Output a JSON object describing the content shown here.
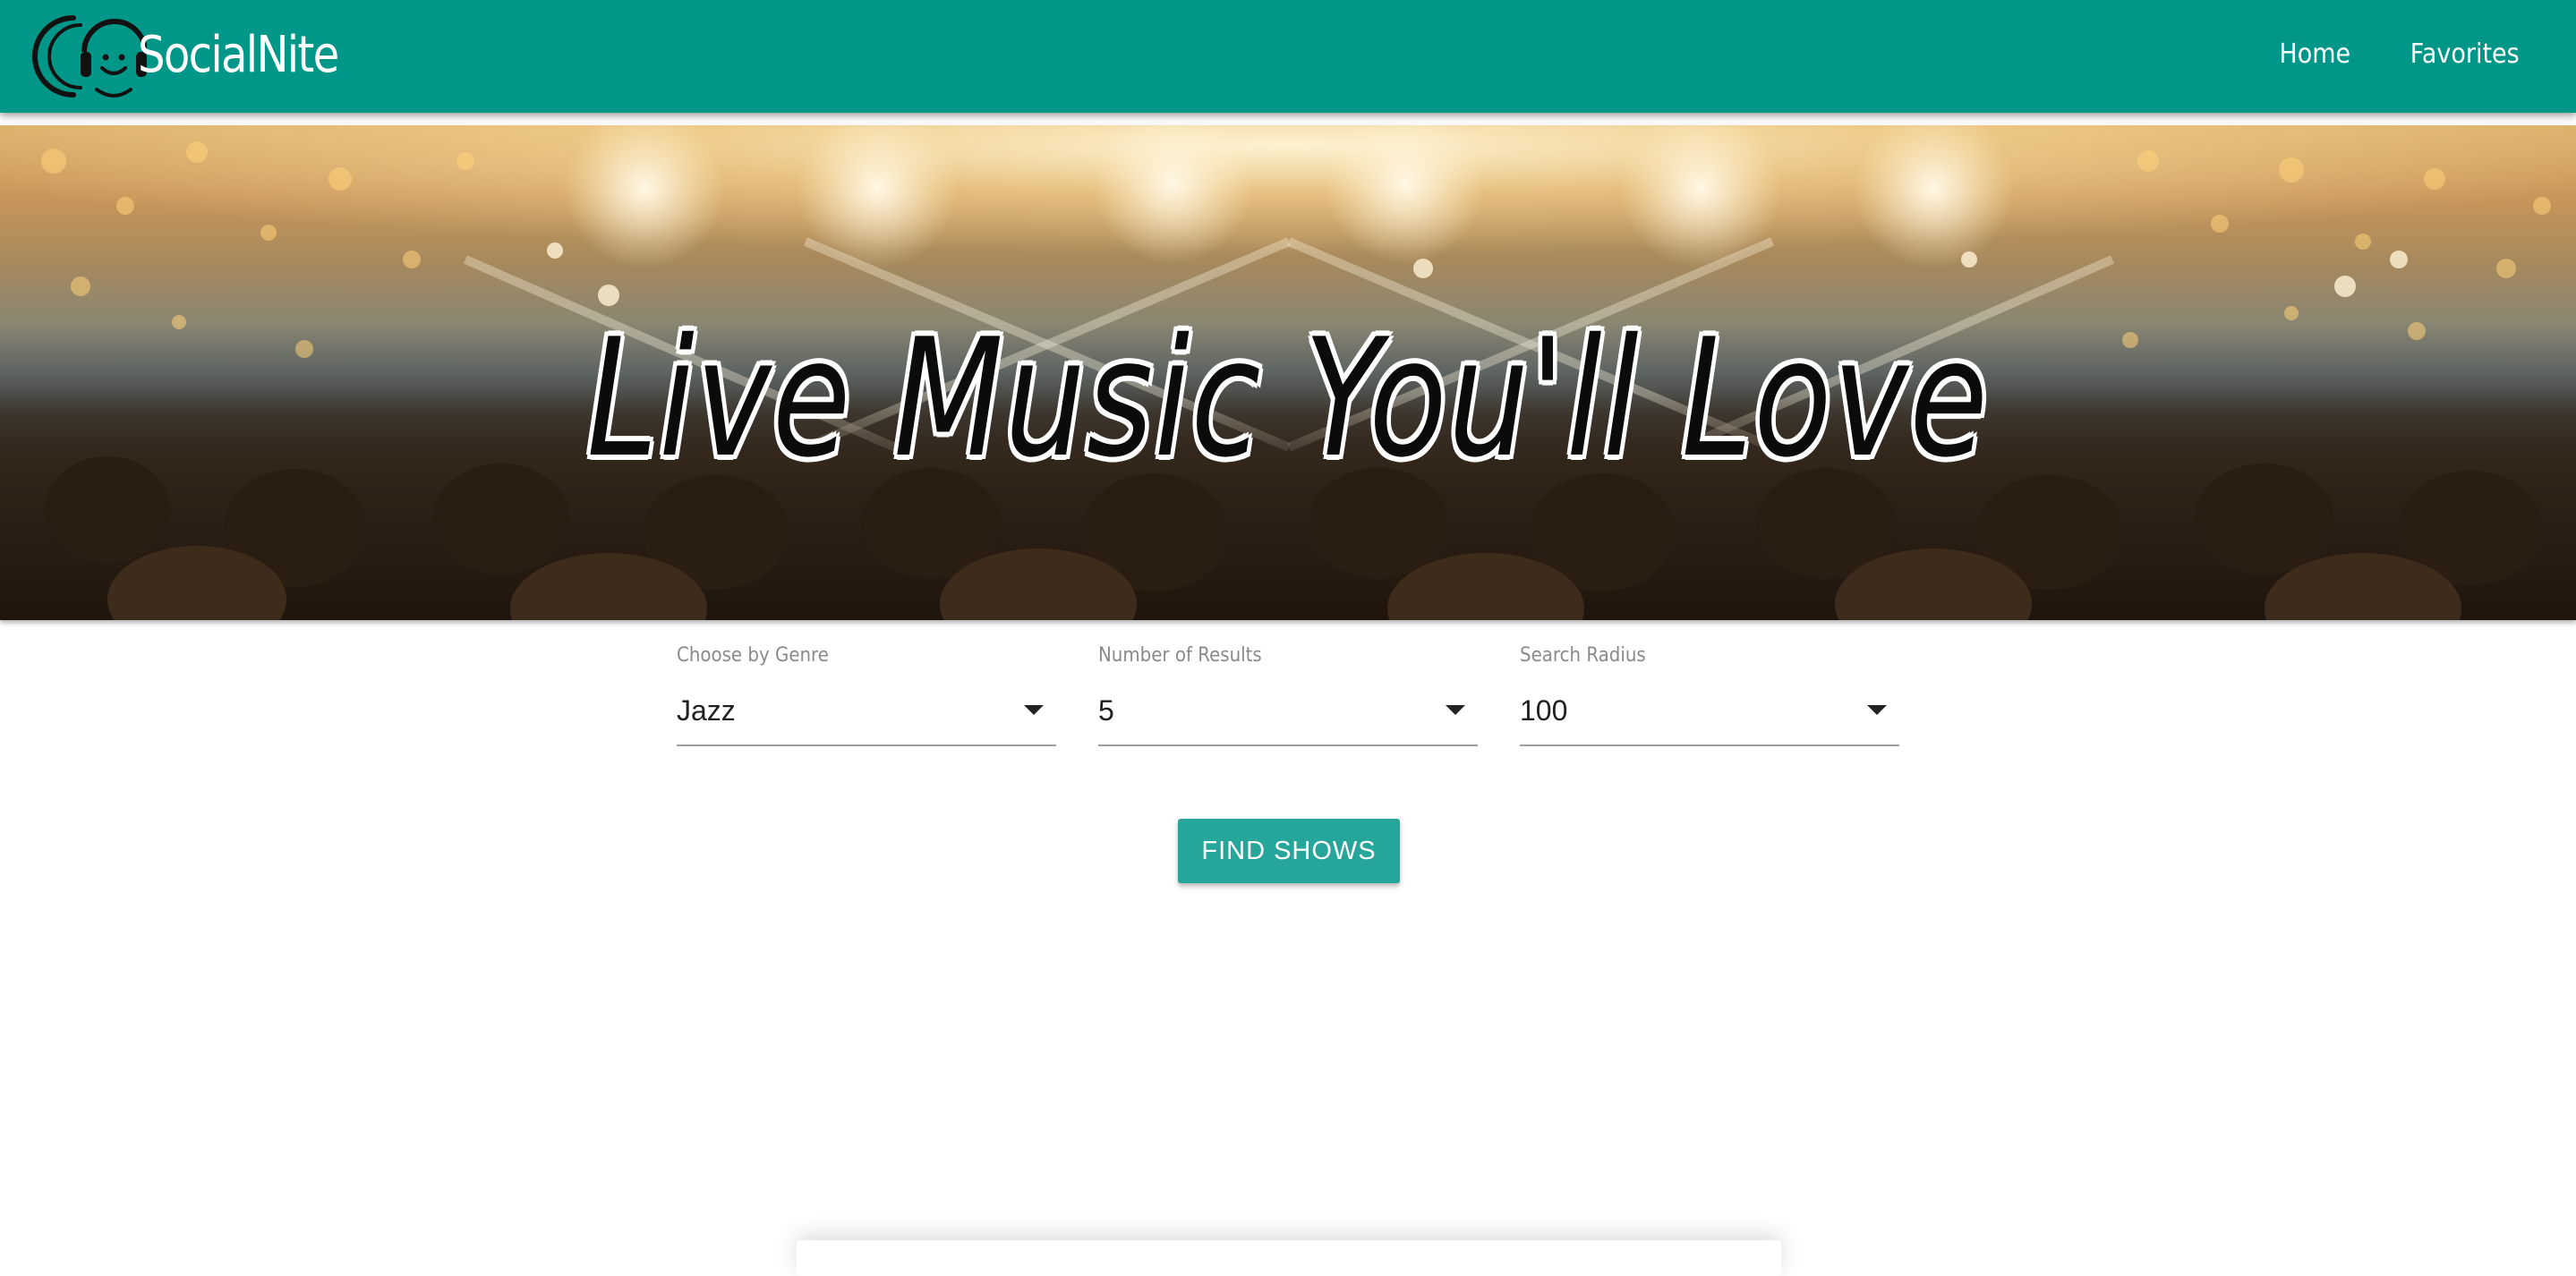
{
  "navbar": {
    "brand": "SocialNite",
    "logo_icon": "headphones-smiley-icon",
    "links": [
      "Home",
      "Favorites"
    ],
    "color": "#009688"
  },
  "hero": {
    "title": "Live Music You'll Love",
    "background": "concert-crowd-stage-lights"
  },
  "form": {
    "genre": {
      "label": "Choose by Genre",
      "value": "Jazz"
    },
    "results": {
      "label": "Number of Results",
      "value": "5"
    },
    "radius": {
      "label": "Search Radius",
      "value": "100"
    }
  },
  "actions": {
    "find_label": "FIND SHOWS",
    "color": "#26a69a"
  }
}
